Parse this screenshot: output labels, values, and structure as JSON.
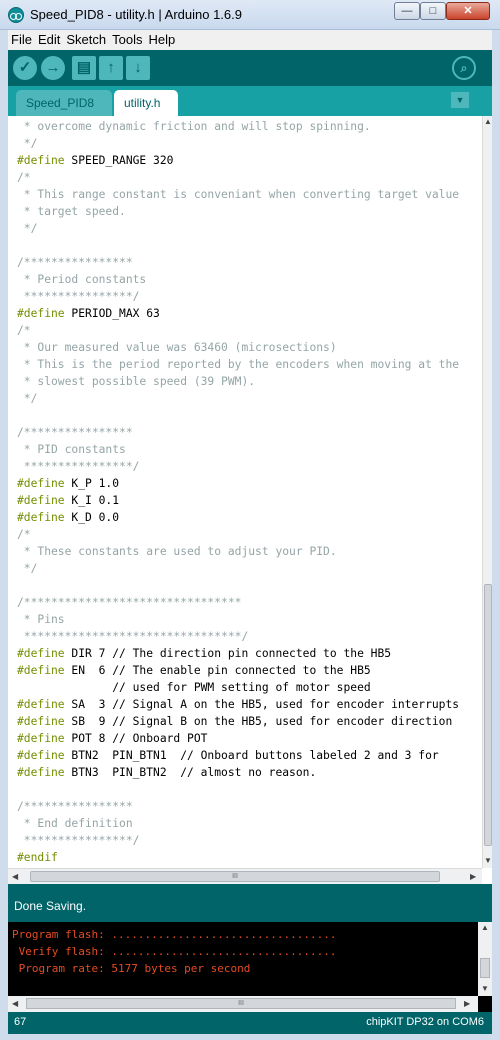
{
  "window": {
    "title": "Speed_PID8 - utility.h | Arduino 1.6.9",
    "min_label": "—",
    "max_label": "□",
    "close_label": "✕"
  },
  "menu": [
    "File",
    "Edit",
    "Sketch",
    "Tools",
    "Help"
  ],
  "toolbar": {
    "verify_icon": "✓",
    "upload_icon": "→",
    "new_icon": "▤",
    "open_icon": "↑",
    "save_icon": "↓",
    "serial_icon": "⌕"
  },
  "tabs": [
    {
      "label": "Speed_PID8",
      "active": false
    },
    {
      "label": "utility.h",
      "active": true
    }
  ],
  "tab_menu_icon": "▼",
  "code_lines": [
    [
      [
        "cm",
        " * overcome dynamic friction and will stop spinning."
      ]
    ],
    [
      [
        "cm",
        " */"
      ]
    ],
    [
      [
        "kw",
        "#define"
      ],
      [
        "tx",
        " SPEED_RANGE 320"
      ]
    ],
    [
      [
        "cm",
        "/*"
      ]
    ],
    [
      [
        "cm",
        " * This range constant is conveniant when converting target value"
      ]
    ],
    [
      [
        "cm",
        " * target speed."
      ]
    ],
    [
      [
        "cm",
        " */"
      ]
    ],
    [
      [
        "tx",
        ""
      ]
    ],
    [
      [
        "cm",
        "/****************"
      ]
    ],
    [
      [
        "cm",
        " * Period constants"
      ]
    ],
    [
      [
        "cm",
        " ****************/"
      ]
    ],
    [
      [
        "kw",
        "#define"
      ],
      [
        "tx",
        " PERIOD_MAX 63"
      ]
    ],
    [
      [
        "cm",
        "/*"
      ]
    ],
    [
      [
        "cm",
        " * Our measured value was 63460 (microsections)"
      ]
    ],
    [
      [
        "cm",
        " * This is the period reported by the encoders when moving at the"
      ]
    ],
    [
      [
        "cm",
        " * slowest possible speed (39 PWM)."
      ]
    ],
    [
      [
        "cm",
        " */"
      ]
    ],
    [
      [
        "tx",
        ""
      ]
    ],
    [
      [
        "cm",
        "/****************"
      ]
    ],
    [
      [
        "cm",
        " * PID constants"
      ]
    ],
    [
      [
        "cm",
        " ****************/"
      ]
    ],
    [
      [
        "kw",
        "#define"
      ],
      [
        "tx",
        " K_P 1.0"
      ]
    ],
    [
      [
        "kw",
        "#define"
      ],
      [
        "tx",
        " K_I 0.1"
      ]
    ],
    [
      [
        "kw",
        "#define"
      ],
      [
        "tx",
        " K_D 0.0"
      ]
    ],
    [
      [
        "cm",
        "/*"
      ]
    ],
    [
      [
        "cm",
        " * These constants are used to adjust your PID."
      ]
    ],
    [
      [
        "cm",
        " */"
      ]
    ],
    [
      [
        "tx",
        ""
      ]
    ],
    [
      [
        "cm",
        "/********************************"
      ]
    ],
    [
      [
        "cm",
        " * Pins"
      ]
    ],
    [
      [
        "cm",
        " ********************************/"
      ]
    ],
    [
      [
        "kw",
        "#define"
      ],
      [
        "tx",
        " DIR 7 // The direction pin connected to the HB5"
      ]
    ],
    [
      [
        "kw",
        "#define"
      ],
      [
        "tx",
        " EN  6 // The enable pin connected to the HB5"
      ]
    ],
    [
      [
        "tx",
        "              // used for PWM setting of motor speed"
      ]
    ],
    [
      [
        "kw",
        "#define"
      ],
      [
        "tx",
        " SA  3 // Signal A on the HB5, used for encoder interrupts"
      ]
    ],
    [
      [
        "kw",
        "#define"
      ],
      [
        "tx",
        " SB  9 // Signal B on the HB5, used for encoder direction"
      ]
    ],
    [
      [
        "kw",
        "#define"
      ],
      [
        "tx",
        " POT 8 // Onboard POT"
      ]
    ],
    [
      [
        "kw",
        "#define"
      ],
      [
        "tx",
        " BTN2  PIN_BTN1  // Onboard buttons labeled 2 and 3 for"
      ]
    ],
    [
      [
        "kw",
        "#define"
      ],
      [
        "tx",
        " BTN3  PIN_BTN2  // almost no reason."
      ]
    ],
    [
      [
        "tx",
        ""
      ]
    ],
    [
      [
        "cm",
        "/****************"
      ]
    ],
    [
      [
        "cm",
        " * End definition"
      ]
    ],
    [
      [
        "cm",
        " ****************/"
      ]
    ],
    [
      [
        "kw",
        "#endif"
      ]
    ]
  ],
  "hscroll_grip": "III",
  "status": "Done Saving.",
  "console_lines": [
    "Program flash: ..................................",
    " Verify flash: ..................................",
    " Program rate: 5177 bytes per second"
  ],
  "footer": {
    "line_number": "67",
    "board": "chipKIT DP32 on COM6"
  },
  "colors": {
    "toolbar": "#006468",
    "tabbar": "#17a1a5",
    "keyword": "#728e00",
    "comment": "#95a5a6",
    "console_text": "#e34c22"
  }
}
